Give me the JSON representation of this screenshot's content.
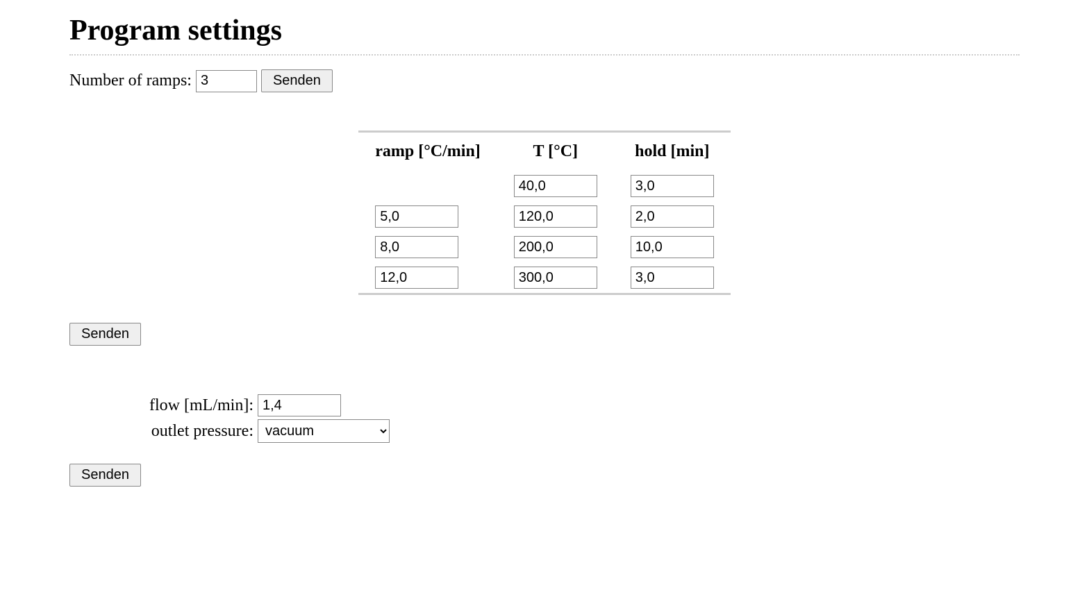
{
  "header": {
    "title": "Program settings"
  },
  "rampCount": {
    "label": "Number of ramps: ",
    "value": "3",
    "submit": "Senden"
  },
  "table": {
    "headers": {
      "ramp": "ramp [°C/min]",
      "t": "T [°C]",
      "hold": "hold [min]"
    },
    "rows": [
      {
        "ramp": "",
        "t": "40,0",
        "hold": "3,0"
      },
      {
        "ramp": "5,0",
        "t": "120,0",
        "hold": "2,0"
      },
      {
        "ramp": "8,0",
        "t": "200,0",
        "hold": "10,0"
      },
      {
        "ramp": "12,0",
        "t": "300,0",
        "hold": "3,0"
      }
    ]
  },
  "tableSubmit": "Senden",
  "flow": {
    "label": "flow [mL/min]: ",
    "value": "1,4"
  },
  "outlet": {
    "label": "outlet pressure: ",
    "selected": "vacuum",
    "options": [
      "vacuum"
    ]
  },
  "bottomSubmit": "Senden"
}
